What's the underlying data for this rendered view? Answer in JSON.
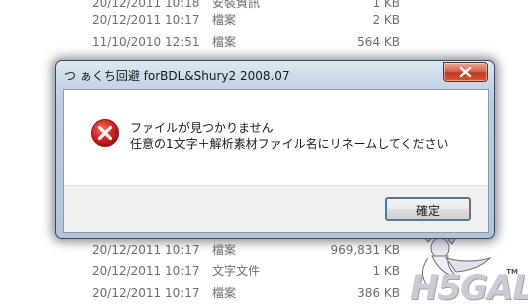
{
  "file_list": {
    "rows": [
      {
        "date": "20/12/2011 10:18",
        "type": "安裝資訊",
        "size": "1 KB"
      },
      {
        "date": "20/12/2011 10:17",
        "type": "檔案",
        "size": "2 KB"
      },
      {
        "date": "11/10/2010 12:51",
        "type": "檔案",
        "size": "564 KB"
      },
      {
        "date": "20/12/2011 10:17",
        "type": "檔案",
        "size": "969,831 KB"
      },
      {
        "date": "20/12/2011 10:17",
        "type": "文字文件",
        "size": "1 KB"
      },
      {
        "date": "20/12/2011 10:17",
        "type": "檔案",
        "size": "386 KB"
      }
    ]
  },
  "dialog": {
    "title": "つ ぁくち回避 forBDL&Shury2 2008.07",
    "message_line1": "ファイルが見つかりません",
    "message_line2": "任意の1文字＋解析素材ファイル名にリネームしてください",
    "ok_label": "確定"
  },
  "watermark": {
    "logo": "H5GAL",
    "trademark": "TM"
  },
  "colors": {
    "error_red": "#d8231f",
    "close_button": "#c2381c",
    "title_glass": "#c9d7e6",
    "accent": "#3c7fb1"
  }
}
